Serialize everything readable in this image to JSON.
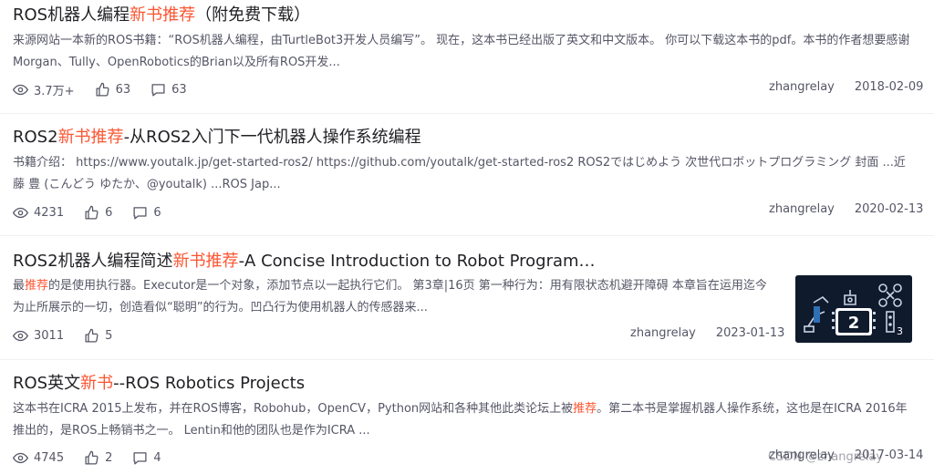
{
  "articles": [
    {
      "title_pre": "ROS机器人编程",
      "title_hl": "新书推荐",
      "title_post": "（附免费下载）",
      "desc_pre": "来源网站一本新的ROS书籍：“ROS机器人编程，由TurtleBot3开发人员编写”。 现在，这本书已经出版了英文和中文版本。 你可以下载这本书的pdf。本书的作者想要感谢Morgan、Tully、OpenRobotics的Brian以及所有ROS开发...",
      "desc_hl": "",
      "desc_post": "",
      "views": "3.7万+",
      "likes": "63",
      "comments": "63",
      "author": "zhangrelay",
      "date": "2018-02-09"
    },
    {
      "title_pre": "ROS2",
      "title_hl": "新书推荐",
      "title_post": "-从ROS2入门下一代机器人操作系统编程",
      "desc_pre": "书籍介绍： https://www.youtalk.jp/get-started-ros2/ https://github.com/youtalk/get-started-ros2 ROS2ではじめよう 次世代ロボットプログラミング 封面 ...近藤 豊 (こんどう ゆたか、@youtalk) ...ROS Jap...",
      "desc_hl": "",
      "desc_post": "",
      "views": "4231",
      "likes": "6",
      "comments": "6",
      "author": "zhangrelay",
      "date": "2020-02-13"
    },
    {
      "title_pre": "ROS2机器人编程简述",
      "title_hl": "新书推荐",
      "title_post": "-A Concise Introduction to Robot Programming ...",
      "desc_pre": "最",
      "desc_hl": "推荐",
      "desc_post": "的是使用执行器。Executor是一个对象，添加节点以一起执行它们。 第3章|16页 第一种行为：用有限状态机避开障碍 本章旨在运用迄今为止所展示的一切，创造看似“聪明”的行为。凹凸行为使用机器人的传感器来...",
      "views": "3011",
      "likes": "5",
      "author": "zhangrelay",
      "date": "2023-01-13",
      "thumb_count": "3"
    },
    {
      "title_pre": "ROS英文",
      "title_hl": "新书",
      "title_post": "--ROS Robotics Projects",
      "desc_pre": "这本书在ICRA 2015上发布，并在ROS博客，Robohub，OpenCV，Python网站和各种其他此类论坛上被",
      "desc_hl": "推荐",
      "desc_post": "。第二本书是掌握机器人操作系统，这也是在ICRA 2016年推出的，是ROS上畅销书之一。 Lentin和他的团队也是作为ICRA ...",
      "views": "4745",
      "likes": "2",
      "comments": "4",
      "author": "zhangrelay",
      "date": "2017-03-14"
    }
  ],
  "watermark": "CSDN @zhangrelay",
  "icons": {
    "views": "eye-icon",
    "likes": "thumb-up-icon",
    "comments": "comment-icon"
  },
  "colors": {
    "highlight": "#fc5531",
    "text": "#222226",
    "meta": "#555666"
  }
}
